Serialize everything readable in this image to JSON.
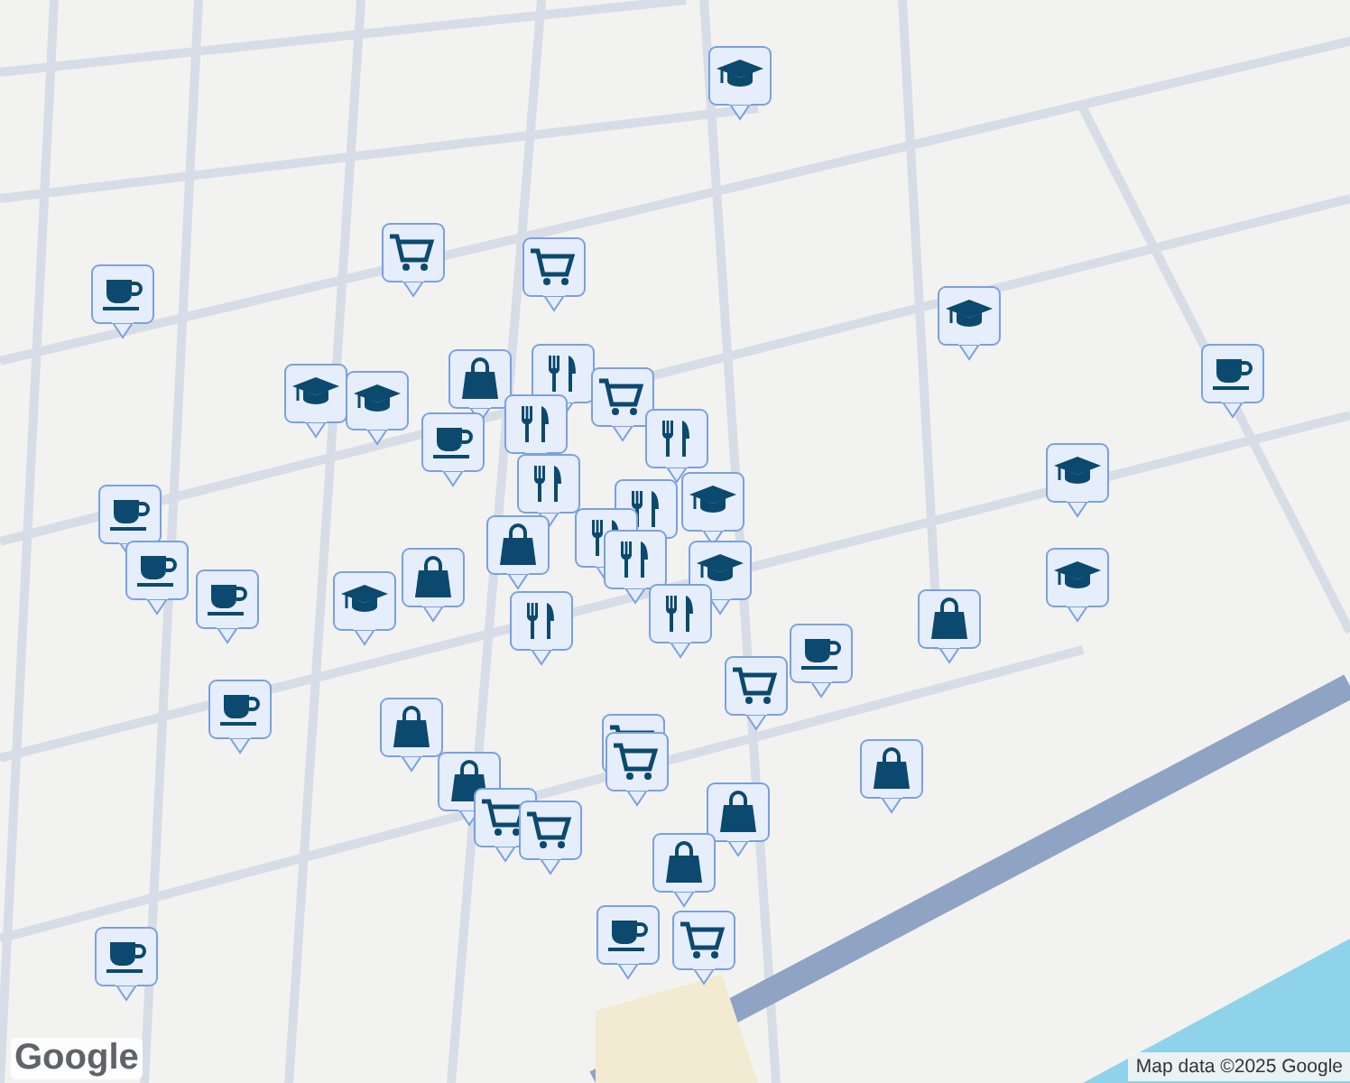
{
  "map": {
    "pins": [
      {
        "kind": "school"
      },
      {
        "kind": "grocery"
      },
      {
        "kind": "grocery"
      },
      {
        "kind": "cafe"
      },
      {
        "kind": "school"
      },
      {
        "kind": "school"
      },
      {
        "kind": "school"
      },
      {
        "kind": "shopping"
      },
      {
        "kind": "restaurant"
      },
      {
        "kind": "grocery"
      },
      {
        "kind": "restaurant"
      },
      {
        "kind": "cafe"
      },
      {
        "kind": "cafe"
      },
      {
        "kind": "restaurant"
      },
      {
        "kind": "restaurant"
      },
      {
        "kind": "school"
      },
      {
        "kind": "cafe"
      },
      {
        "kind": "cafe"
      },
      {
        "kind": "restaurant"
      },
      {
        "kind": "shopping"
      },
      {
        "kind": "restaurant"
      },
      {
        "kind": "restaurant"
      },
      {
        "kind": "school"
      },
      {
        "kind": "school"
      },
      {
        "kind": "shopping"
      },
      {
        "kind": "cafe"
      },
      {
        "kind": "restaurant"
      },
      {
        "kind": "restaurant"
      },
      {
        "kind": "school"
      },
      {
        "kind": "school"
      },
      {
        "kind": "shopping"
      },
      {
        "kind": "cafe"
      },
      {
        "kind": "grocery"
      },
      {
        "kind": "cafe"
      },
      {
        "kind": "shopping"
      },
      {
        "kind": "grocery"
      },
      {
        "kind": "grocery"
      },
      {
        "kind": "shopping"
      },
      {
        "kind": "shopping"
      },
      {
        "kind": "shopping"
      },
      {
        "kind": "grocery"
      },
      {
        "kind": "grocery"
      },
      {
        "kind": "shopping"
      },
      {
        "kind": "grocery"
      },
      {
        "kind": "cafe"
      },
      {
        "kind": "cafe"
      }
    ]
  },
  "logo": "Google",
  "attribution": "Map data ©2025 Google"
}
